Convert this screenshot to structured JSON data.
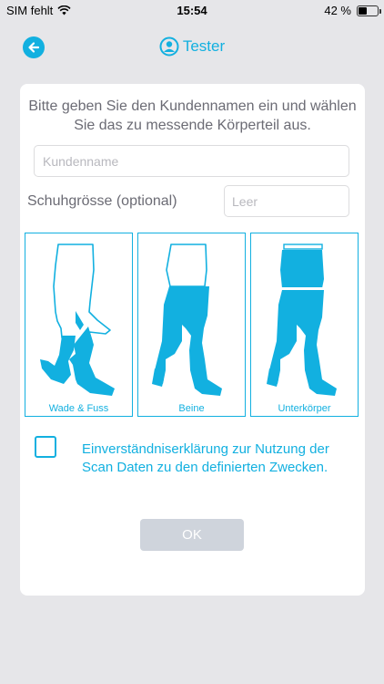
{
  "status_bar": {
    "carrier": "SIM fehlt",
    "time": "15:54",
    "battery": "42 %",
    "wifi_icon": "wifi-icon",
    "battery_icon": "battery-icon"
  },
  "nav": {
    "back_icon": "arrow-left-icon",
    "user_icon": "user-circle-icon",
    "title": "Tester"
  },
  "form": {
    "intro": "Bitte geben Sie den Kundennamen ein und wählen Sie das zu messende Körperteil aus.",
    "customer_name_placeholder": "Kundenname",
    "customer_name_value": "",
    "shoe_size_label": "Schuhgrösse (optional)",
    "shoe_size_placeholder": "Leer",
    "shoe_size_value": ""
  },
  "body_parts": [
    {
      "label": "Wade & Fuss",
      "icon": "calf-foot-icon"
    },
    {
      "label": "Beine",
      "icon": "legs-icon"
    },
    {
      "label": "Unterkörper",
      "icon": "lower-body-icon"
    }
  ],
  "consent": {
    "checked": false,
    "text": "Einverständniserklärung zur Nutzung der Scan Daten zu den definierten Zwecken."
  },
  "ok_button": {
    "label": "OK",
    "enabled": false
  },
  "colors": {
    "accent": "#12b0e0",
    "background": "#e6e6e9",
    "card": "#ffffff",
    "text_gray": "#6b6b74",
    "button_disabled": "#cfd4dc"
  }
}
